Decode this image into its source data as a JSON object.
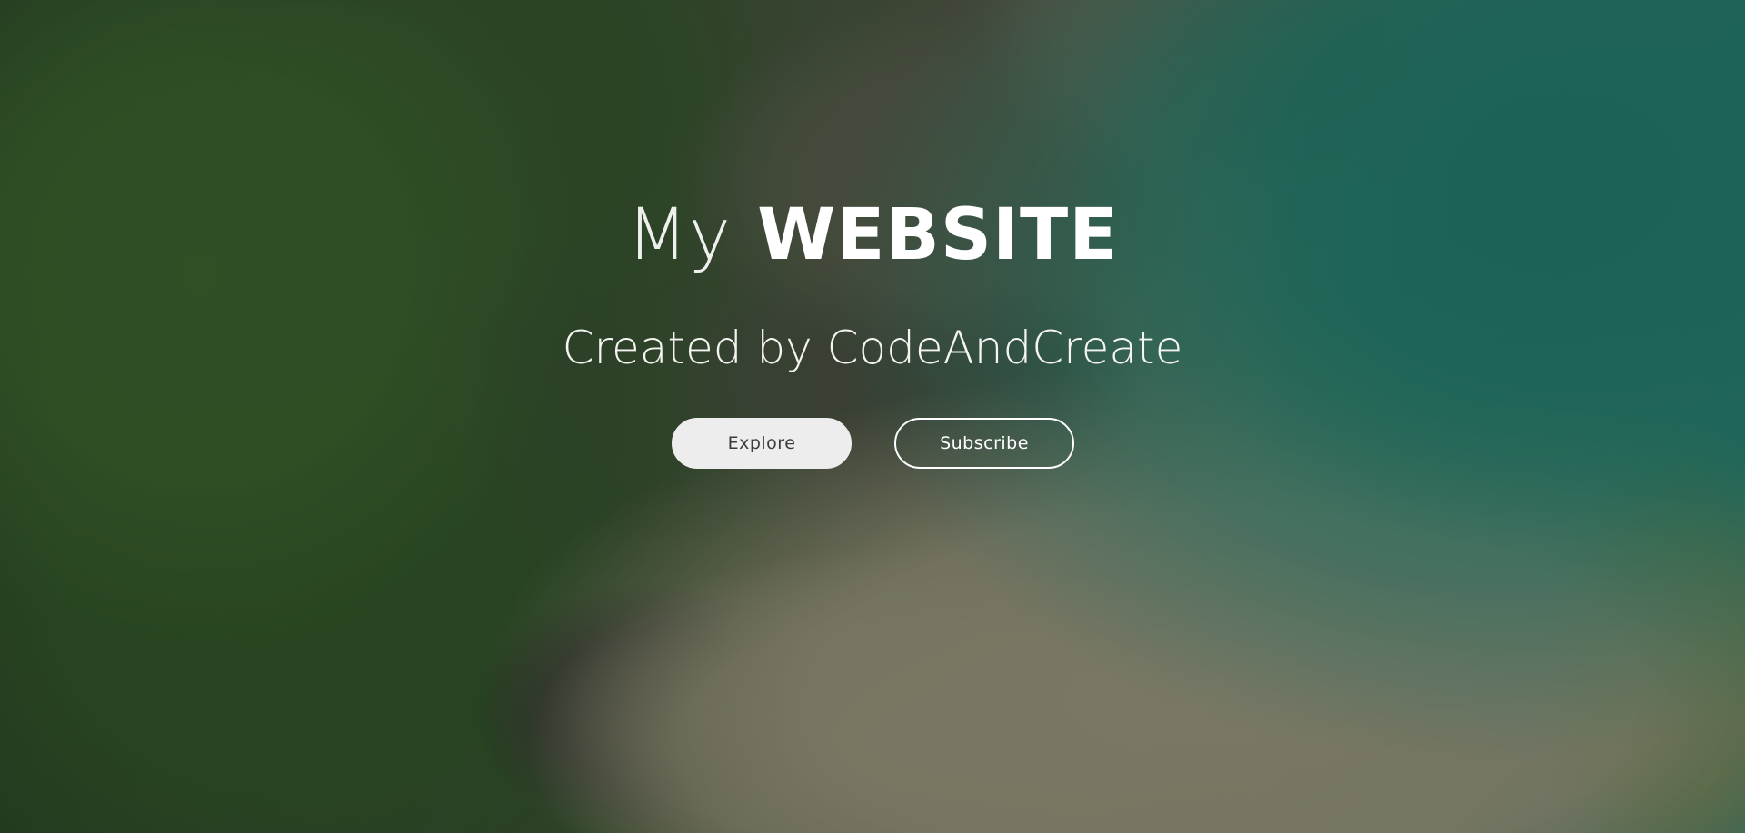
{
  "hero": {
    "title_light": "My",
    "title_bold": "WEBSITE",
    "subtitle": "Created by CodeAndCreate",
    "buttons": {
      "explore_label": "Explore",
      "subscribe_label": "Subscribe"
    }
  },
  "colors": {
    "explore_button_bg": "#ededed",
    "subscribe_button_border": "#ffffff",
    "text": "#ffffff"
  }
}
